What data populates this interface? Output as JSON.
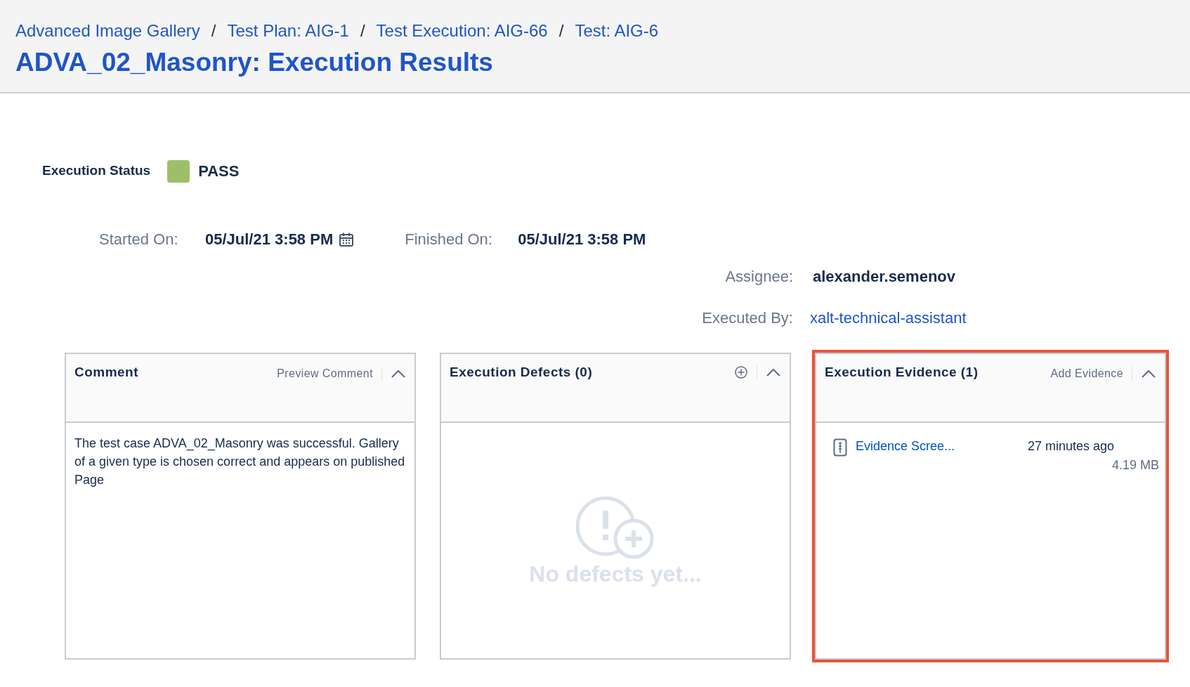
{
  "breadcrumbs": [
    "Advanced Image Gallery",
    "Test Plan: AIG-1",
    "Test Execution: AIG-66",
    "Test: AIG-6"
  ],
  "separator": "/",
  "title": "ADVA_02_Masonry: Execution Results",
  "execution_status": {
    "label": "Execution Status",
    "value": "PASS",
    "color": "#9cc06a"
  },
  "started_on": {
    "label": "Started On:",
    "value": "05/Jul/21 3:58 PM"
  },
  "finished_on": {
    "label": "Finished On:",
    "value": "05/Jul/21 3:58 PM"
  },
  "assignee": {
    "label": "Assignee:",
    "value": "alexander.semenov"
  },
  "executed_by": {
    "label": "Executed By:",
    "value": "xalt-technical-assistant"
  },
  "panels": [
    {
      "kind": "comment",
      "title": "Comment",
      "action": "Preview Comment",
      "highlighted": false,
      "text": "The test case ADVA_02_Masonry was successful. Gallery of a given type is chosen correct and appears on published Page"
    },
    {
      "kind": "defects",
      "title": "Execution Defects (0)",
      "highlighted": false,
      "empty_text": "No defects yet..."
    },
    {
      "kind": "evidence",
      "title": "Execution Evidence (1)",
      "action": "Add Evidence",
      "highlighted": true,
      "files": [
        {
          "name": "Evidence Scree...",
          "time": "27 minutes ago",
          "size": "4.19 MB"
        }
      ]
    }
  ]
}
